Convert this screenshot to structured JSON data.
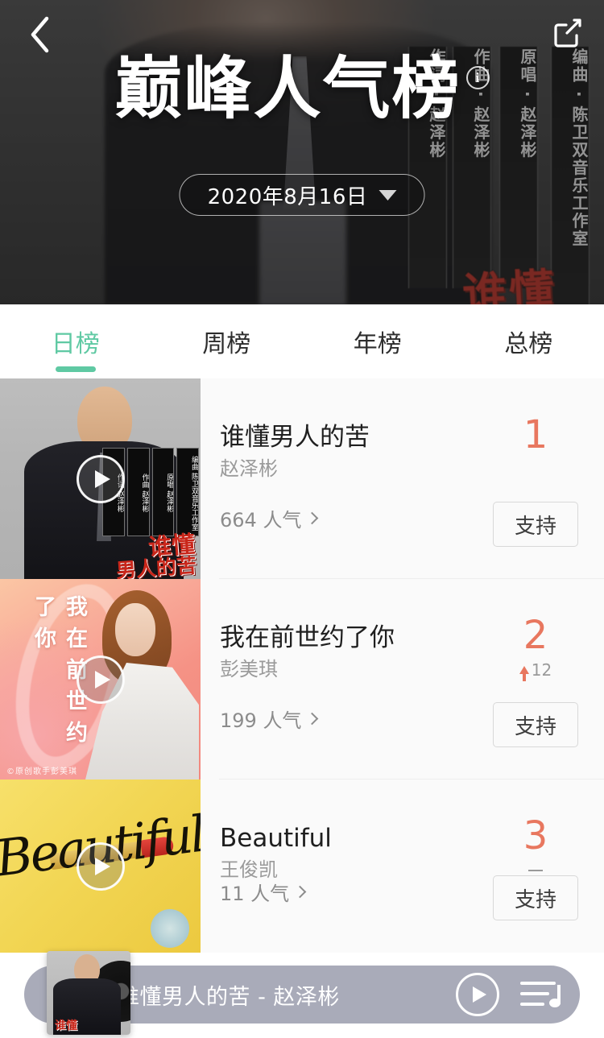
{
  "header": {
    "back_icon": "chevron-left-icon",
    "share_icon": "share-external-icon",
    "title": "巅峰人气榜",
    "info_icon": "i",
    "date": "2020年8月16日",
    "date_caret_icon": "caret-down-icon",
    "hero_poster": {
      "columns": [
        "作词 · 赵泽彬",
        "作曲 · 赵泽彬",
        "原唱 · 赵泽彬",
        "编曲 · 陈卫双音乐工作室"
      ],
      "red_title": "谁懂"
    }
  },
  "tabs": [
    {
      "label": "日榜",
      "active": true
    },
    {
      "label": "周榜",
      "active": false
    },
    {
      "label": "年榜",
      "active": false
    },
    {
      "label": "总榜",
      "active": false
    }
  ],
  "list": [
    {
      "title": "谁懂男人的苦",
      "artist": "赵泽彬",
      "popularity": "664 人气",
      "rank": "1",
      "delta": "",
      "delta_type": "none",
      "support_label": "支持",
      "art": {
        "kind": "suited-man",
        "columns": [
          "作词 赵泽彬",
          "作曲 赵泽彬",
          "原唱 赵泽彬",
          "编曲 陈卫双音乐工作室"
        ],
        "red_line1": "谁懂",
        "red_line2": "男人的苦"
      }
    },
    {
      "title": "我在前世约了你",
      "artist": "彭美琪",
      "popularity": "199 人气",
      "rank": "2",
      "delta": "12",
      "delta_type": "up",
      "support_label": "支持",
      "art": {
        "kind": "lady-coral",
        "vertical_text": "我在前世约了你",
        "credit": "©原创歌手彭美琪"
      }
    },
    {
      "title": "Beautiful",
      "artist": "王俊凯",
      "popularity": "11 人气",
      "rank": "3",
      "delta": "",
      "delta_type": "flat",
      "support_label": "支持",
      "art": {
        "kind": "beautiful-yellow",
        "script_text": "Beautiful"
      }
    }
  ],
  "player": {
    "now_playing": "谁懂男人的苦 - 赵泽彬",
    "play_icon": "play-icon",
    "playlist_icon": "playlist-music-icon",
    "art_red_text": "谁懂"
  },
  "colors": {
    "accent_green": "#5fc9a3",
    "rank_coral": "#e8775f",
    "list_bg": "#fafafa",
    "player_bg": "rgba(150,153,170,.82)"
  }
}
